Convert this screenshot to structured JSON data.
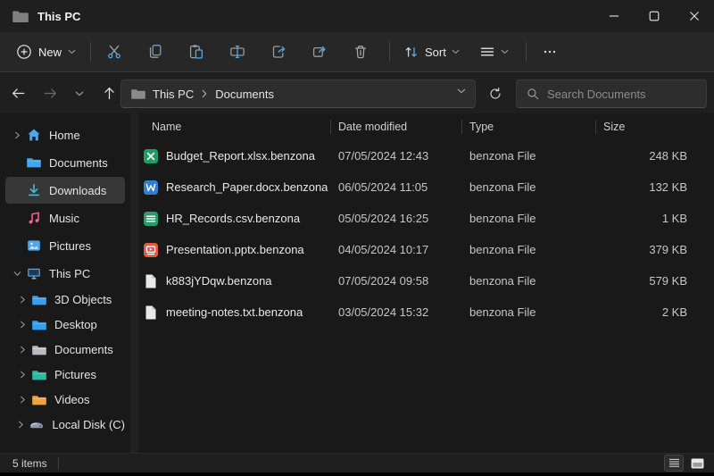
{
  "window": {
    "title": "This PC"
  },
  "toolbar": {
    "new_label": "New",
    "sort_label": "Sort"
  },
  "addressbar": {
    "crumbs": [
      "This PC",
      "Documents"
    ]
  },
  "search": {
    "placeholder": "Search Documents"
  },
  "sidebar": {
    "items": [
      {
        "label": "Home",
        "icon": "home",
        "chevron": "collapsed",
        "indent": 0
      },
      {
        "label": "Documents",
        "icon": "folder-documents",
        "chevron": "none",
        "indent": 0
      },
      {
        "label": "Downloads",
        "icon": "download",
        "chevron": "none",
        "indent": 0,
        "selected": true
      },
      {
        "label": "Music",
        "icon": "music",
        "chevron": "none",
        "indent": 0
      },
      {
        "label": "Pictures",
        "icon": "picture",
        "chevron": "none",
        "indent": 0
      },
      {
        "label": "This PC",
        "icon": "computer",
        "chevron": "expanded",
        "indent": 0
      },
      {
        "label": "3D Objects",
        "icon": "folder-blue",
        "chevron": "collapsed",
        "indent": 1
      },
      {
        "label": "Desktop",
        "icon": "folder-desktop",
        "chevron": "collapsed",
        "indent": 1
      },
      {
        "label": "Documents",
        "icon": "folder-gray",
        "chevron": "collapsed",
        "indent": 1
      },
      {
        "label": "Pictures",
        "icon": "folder-teal",
        "chevron": "collapsed",
        "indent": 1
      },
      {
        "label": "Videos",
        "icon": "folder-orange",
        "chevron": "collapsed",
        "indent": 1
      },
      {
        "label": "Local Disk (C)",
        "icon": "disk",
        "chevron": "collapsed",
        "indent": 1
      }
    ]
  },
  "list": {
    "columns": [
      "Name",
      "Date modified",
      "Type",
      "Size"
    ],
    "rows": [
      {
        "name": "Budget_Report.xlsx.benzona",
        "date": "07/05/2024 12:43",
        "type": "benzona File",
        "size": "248 KB",
        "icon": "excel"
      },
      {
        "name": "Research_Paper.docx.benzona",
        "date": "06/05/2024 11:05",
        "type": "benzona File",
        "size": "132 KB",
        "icon": "word"
      },
      {
        "name": "HR_Records.csv.benzona",
        "date": "05/05/2024 16:25",
        "type": "benzona File",
        "size": "1 KB",
        "icon": "csv"
      },
      {
        "name": "Presentation.pptx.benzona",
        "date": "04/05/2024 10:17",
        "type": "benzona File",
        "size": "379 KB",
        "icon": "powerpoint"
      },
      {
        "name": "k883jYDqw.benzona",
        "date": "07/05/2024 09:58",
        "type": "benzona File",
        "size": "579 KB",
        "icon": "file"
      },
      {
        "name": "meeting-notes.txt.benzona",
        "date": "03/05/2024 15:32",
        "type": "benzona File",
        "size": "2 KB",
        "icon": "file"
      }
    ]
  },
  "statusbar": {
    "item_count": "5 items"
  },
  "colors": {
    "accent_blue": "#53a7ea",
    "selection_bg": "#373737",
    "window_bg": "#191919",
    "titlebar_bg": "#1f1f1f",
    "toolbar_bg": "#272727",
    "input_bg": "#2d2d2d",
    "excel_green": "#1e9e63",
    "word_blue": "#2f7fd4",
    "csv_green": "#259e68",
    "powerpoint_red": "#e2593f",
    "download_teal": "#4db8cf",
    "music_pink": "#ef6a8c",
    "folder_blue": "#38a1ee",
    "folder_gray": "#b7bcc2",
    "folder_teal": "#2fb9a4",
    "folder_orange": "#f2a23c"
  }
}
